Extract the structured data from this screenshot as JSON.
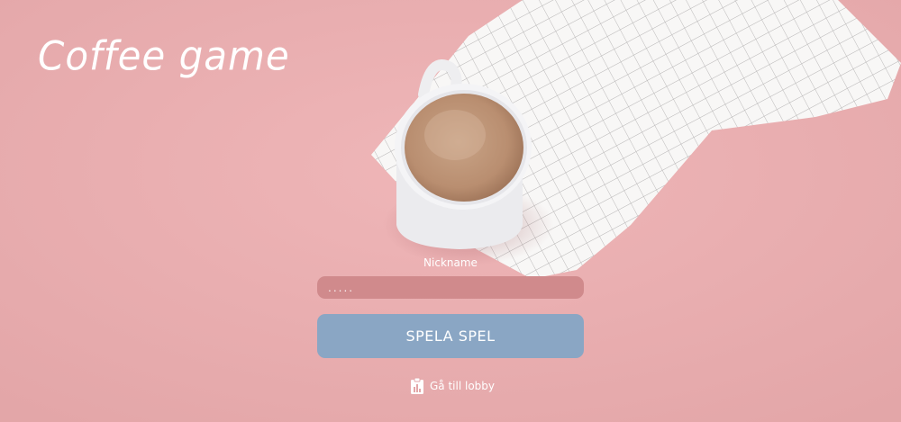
{
  "app": {
    "title": "Coffee game"
  },
  "form": {
    "nickname_label": "Nickname",
    "nickname_placeholder": ".....",
    "nickname_value": "",
    "play_button_label": "SPELA SPEL"
  },
  "lobby": {
    "link_label": "Gå till lobby",
    "icon": "clipboard-chart-icon"
  },
  "colors": {
    "background": "#e8aeb0",
    "input_background": "#d08a8c",
    "button_background": "#8aa6c4",
    "text": "#ffffff"
  }
}
